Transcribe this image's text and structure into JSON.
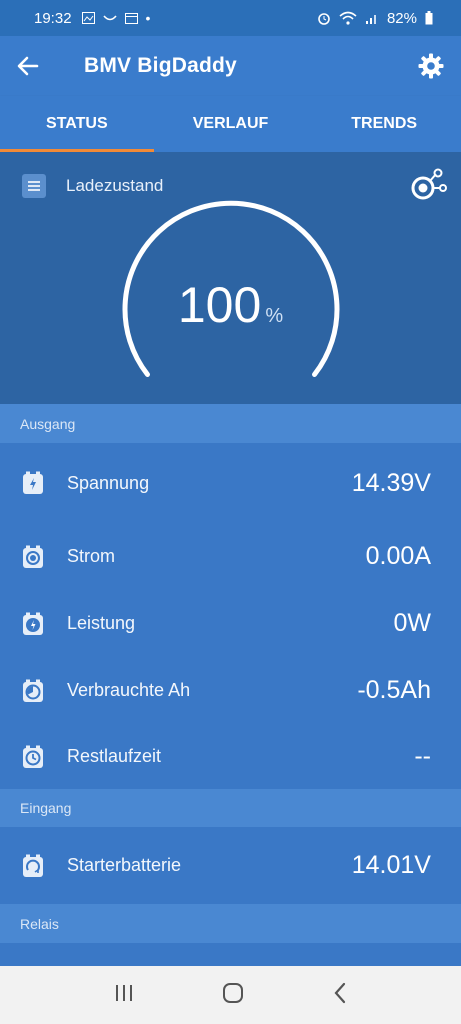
{
  "status_bar": {
    "time": "19:32",
    "battery": "82%"
  },
  "app_bar": {
    "title": "BMV BigDaddy"
  },
  "tabs": [
    {
      "label": "STATUS",
      "active": true
    },
    {
      "label": "VERLAUF",
      "active": false
    },
    {
      "label": "TRENDS",
      "active": false
    }
  ],
  "soc": {
    "label": "Ladezustand",
    "value": "100",
    "unit": "%",
    "level_percent": 100
  },
  "sections": {
    "output": "Ausgang",
    "input": "Eingang",
    "relay": "Relais"
  },
  "output_rows": [
    {
      "name": "Spannung",
      "value": "14.39V",
      "icon": "bolt-icon"
    },
    {
      "name": "Strom",
      "value": "0.00A",
      "icon": "circle-dot-icon"
    },
    {
      "name": "Leistung",
      "value": "0W",
      "icon": "power-bolt-icon"
    },
    {
      "name": "Verbrauchte Ah",
      "value": "-0.5Ah",
      "icon": "consumed-icon"
    },
    {
      "name": "Restlaufzeit",
      "value": "--",
      "icon": "clock-icon"
    }
  ],
  "input_rows": [
    {
      "name": "Starterbatterie",
      "value": "14.01V",
      "icon": "starter-icon"
    }
  ],
  "colors": {
    "accent": "#f28a36",
    "primary": "#3a78c6",
    "header": "#2d64a3"
  }
}
